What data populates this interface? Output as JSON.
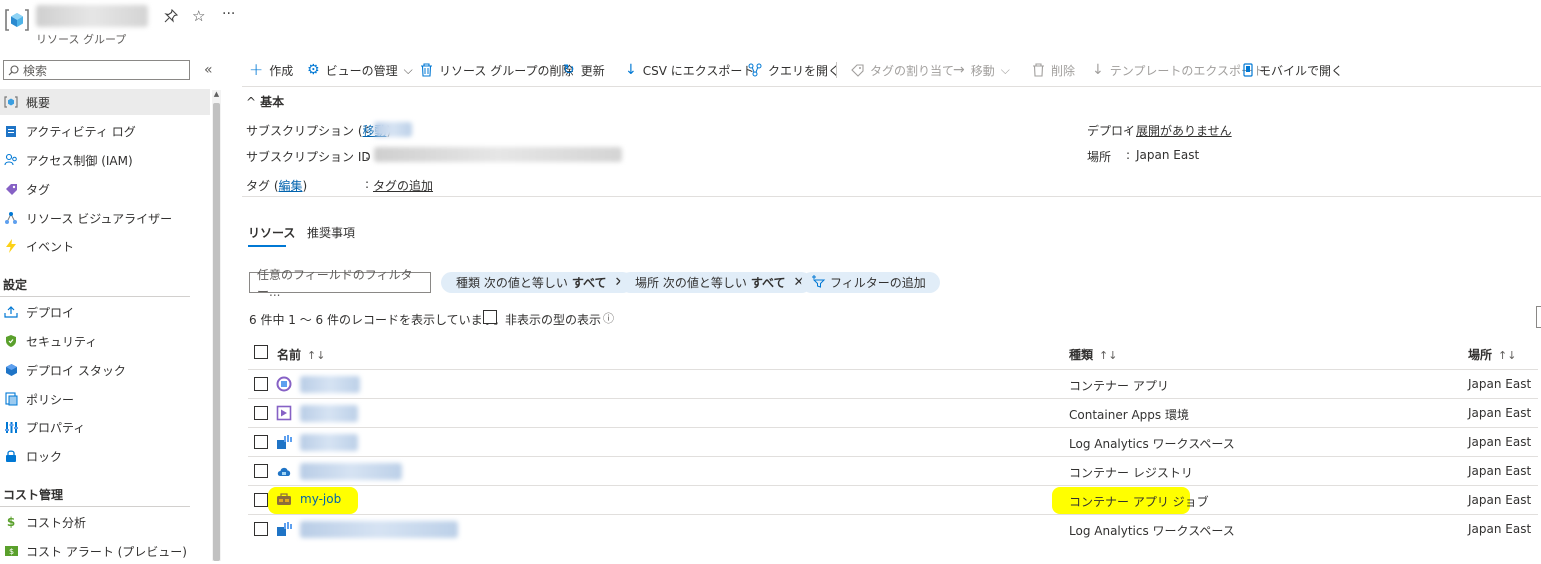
{
  "header": {
    "resource_type": "リソース グループ",
    "pin_glyph": "⚲",
    "star_glyph": "☆",
    "more_glyph": "···"
  },
  "sidebar": {
    "search_placeholder": "検索",
    "collapse_glyph": "«",
    "items": [
      {
        "label": "概要",
        "icon": "overview-icon"
      },
      {
        "label": "アクティビティ ログ",
        "icon": "activity-log-icon"
      },
      {
        "label": "アクセス制御 (IAM)",
        "icon": "iam-icon"
      },
      {
        "label": "タグ",
        "icon": "tag-icon"
      },
      {
        "label": "リソース ビジュアライザー",
        "icon": "visualizer-icon"
      },
      {
        "label": "イベント",
        "icon": "events-icon"
      }
    ],
    "section_settings": "設定",
    "settings_items": [
      {
        "label": "デプロイ",
        "icon": "deploy-icon"
      },
      {
        "label": "セキュリティ",
        "icon": "security-icon"
      },
      {
        "label": "デプロイ スタック",
        "icon": "deploy-stack-icon"
      },
      {
        "label": "ポリシー",
        "icon": "policy-icon"
      },
      {
        "label": "プロパティ",
        "icon": "properties-icon"
      },
      {
        "label": "ロック",
        "icon": "lock-icon"
      }
    ],
    "section_cost": "コスト管理",
    "cost_items": [
      {
        "label": "コスト分析",
        "icon": "cost-analysis-icon"
      },
      {
        "label": "コスト アラート (プレビュー)",
        "icon": "cost-alert-icon"
      }
    ]
  },
  "toolbar": {
    "create": "作成",
    "manage_view": "ビューの管理",
    "delete_rg": "リソース グループの削除",
    "refresh": "更新",
    "export_csv": "CSV にエクスポート",
    "open_query": "クエリを開く",
    "assign_tags": "タグの割り当て",
    "move": "移動",
    "delete": "削除",
    "export_template": "テンプレートのエクスポート",
    "open_mobile": "モバイルで開く"
  },
  "essentials": {
    "title": "基本",
    "subscription_label": "サブスクリプション",
    "move_link": "移動",
    "subscription_id_label": "サブスクリプション ID",
    "tags_label": "タグ",
    "edit_link": "編集",
    "add_tags_link": "タグの追加",
    "deploy_label": "デプロイ",
    "deploy_value": "展開がありません",
    "location_label": "場所",
    "location_value": "Japan East"
  },
  "tabs": {
    "resources": "リソース",
    "recommendations": "推奨事項"
  },
  "filter": {
    "placeholder": "任意のフィールドのフィルター...",
    "type_pill_pre": "種類 次の値と等しい",
    "type_pill_val": "すべて",
    "loc_pill_pre": "場所 次の値と等しい",
    "loc_pill_val": "すべて",
    "add_filter": "フィルターの追加"
  },
  "records": {
    "count_text": "6 件中 1 ～ 6 件のレコードを表示しています。",
    "show_hidden": "非表示の型の表示"
  },
  "table": {
    "col_name": "名前",
    "col_type": "種類",
    "col_location": "場所",
    "sort_glyph": "↑↓",
    "rows": [
      {
        "name": "",
        "type": "コンテナー アプリ",
        "location": "Japan East",
        "icon": "container-app-icon"
      },
      {
        "name": "",
        "type": "Container Apps 環境",
        "location": "Japan East",
        "icon": "container-apps-env-icon"
      },
      {
        "name": "",
        "type": "Log Analytics ワークスペース",
        "location": "Japan East",
        "icon": "log-analytics-icon"
      },
      {
        "name": "",
        "type": "コンテナー レジストリ",
        "location": "Japan East",
        "icon": "container-registry-icon"
      },
      {
        "name": "my-job",
        "type": "コンテナー アプリ ジョブ",
        "location": "Japan East",
        "icon": "container-app-job-icon"
      },
      {
        "name": "",
        "type": "Log Analytics ワークスペース",
        "location": "Japan East",
        "icon": "log-analytics-icon"
      }
    ]
  },
  "colors": {
    "accent": "#0078d4",
    "link": "#0062ad",
    "highlight": "#ffff00",
    "pill_bg": "#e1edf8"
  }
}
